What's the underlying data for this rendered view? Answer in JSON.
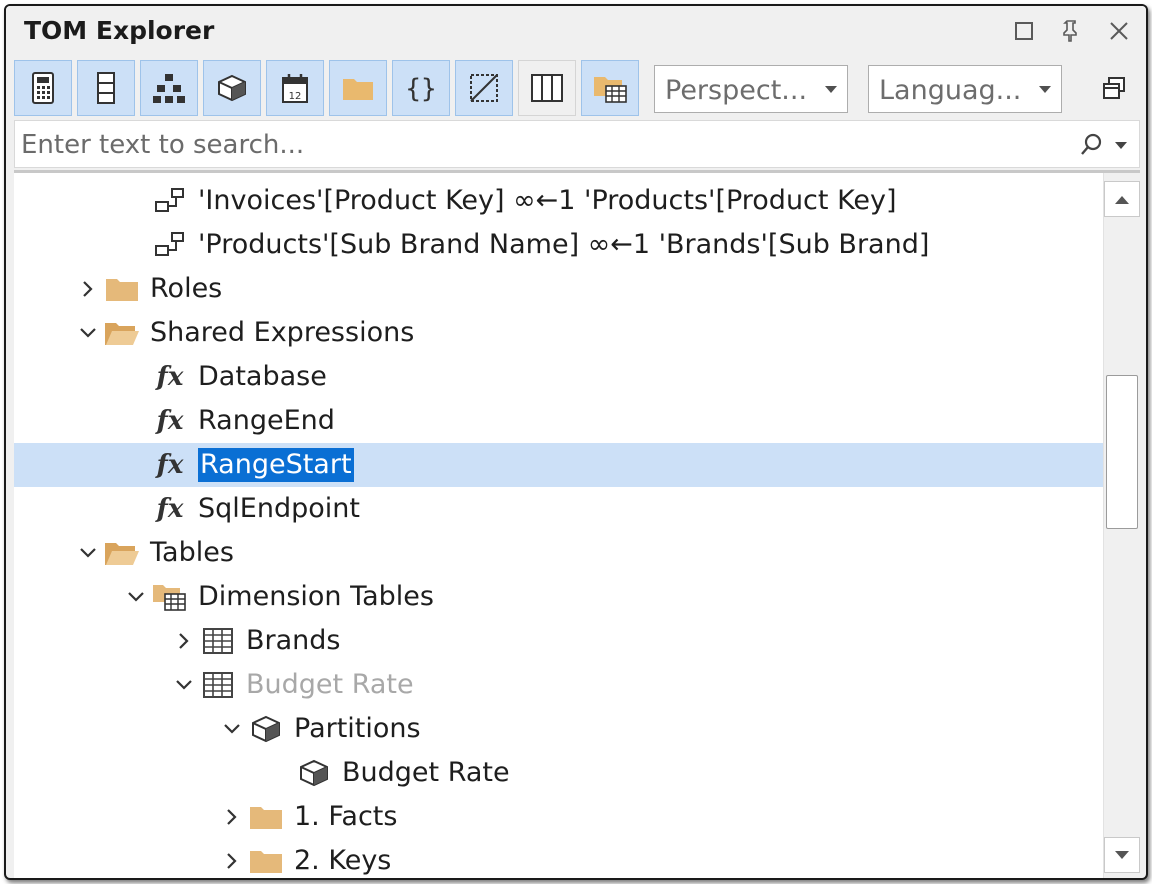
{
  "window": {
    "title": "TOM Explorer"
  },
  "titlebar_buttons": [
    {
      "name": "restore-icon"
    },
    {
      "name": "pin-icon"
    },
    {
      "name": "close-icon"
    }
  ],
  "toolbar": {
    "buttons": [
      {
        "name": "calculator-icon",
        "active": true
      },
      {
        "name": "column-list-icon",
        "active": true
      },
      {
        "name": "hierarchy-icon",
        "active": true
      },
      {
        "name": "partition-icon",
        "active": true
      },
      {
        "name": "calendar-icon",
        "active": true
      },
      {
        "name": "folder-icon",
        "active": true
      },
      {
        "name": "braces-icon",
        "active": true
      },
      {
        "name": "measure-icon",
        "active": true
      },
      {
        "name": "columns-icon",
        "active": false
      },
      {
        "name": "display-folder-icon",
        "active": true
      }
    ],
    "perspective_label": "Perspect...",
    "language_label": "Languag...",
    "options_icon": "copy-window-icon"
  },
  "search": {
    "placeholder": "Enter text to search...",
    "icon": "search-icon"
  },
  "tree": {
    "rows": [
      {
        "level": 3,
        "icon": "relationship",
        "chevron": "none",
        "label": "'Invoices'[Product Key] ∞←1 'Products'[Product Key]"
      },
      {
        "level": 3,
        "icon": "relationship",
        "chevron": "none",
        "label": "'Products'[Sub Brand Name] ∞←1 'Brands'[Sub Brand]"
      },
      {
        "level": 2,
        "icon": "folder",
        "chevron": "right",
        "label": "Roles"
      },
      {
        "level": 2,
        "icon": "folder-open",
        "chevron": "down",
        "label": "Shared Expressions"
      },
      {
        "level": 3,
        "icon": "fx",
        "chevron": "none",
        "label": "Database"
      },
      {
        "level": 3,
        "icon": "fx",
        "chevron": "none",
        "label": "RangeEnd"
      },
      {
        "level": 3,
        "icon": "fx",
        "chevron": "none",
        "label": "RangeStart",
        "selected": true
      },
      {
        "level": 3,
        "icon": "fx",
        "chevron": "none",
        "label": "SqlEndpoint"
      },
      {
        "level": 2,
        "icon": "folder-open",
        "chevron": "down",
        "label": "Tables"
      },
      {
        "level": 3,
        "icon": "table-folder",
        "chevron": "down",
        "label": "Dimension Tables"
      },
      {
        "level": 4,
        "icon": "table",
        "chevron": "right",
        "label": "Brands"
      },
      {
        "level": 4,
        "icon": "table",
        "chevron": "down",
        "label": "Budget Rate",
        "dim": true
      },
      {
        "level": 5,
        "icon": "partition",
        "chevron": "down",
        "label": "Partitions"
      },
      {
        "level": 6,
        "icon": "partition",
        "chevron": "none",
        "label": "Budget Rate"
      },
      {
        "level": 5,
        "icon": "folder",
        "chevron": "right",
        "label": "1. Facts"
      },
      {
        "level": 5,
        "icon": "folder",
        "chevron": "right",
        "label": "2. Keys"
      }
    ]
  },
  "scrollbar": {
    "up_icon": "scroll-up-icon",
    "down_icon": "scroll-down-icon"
  }
}
